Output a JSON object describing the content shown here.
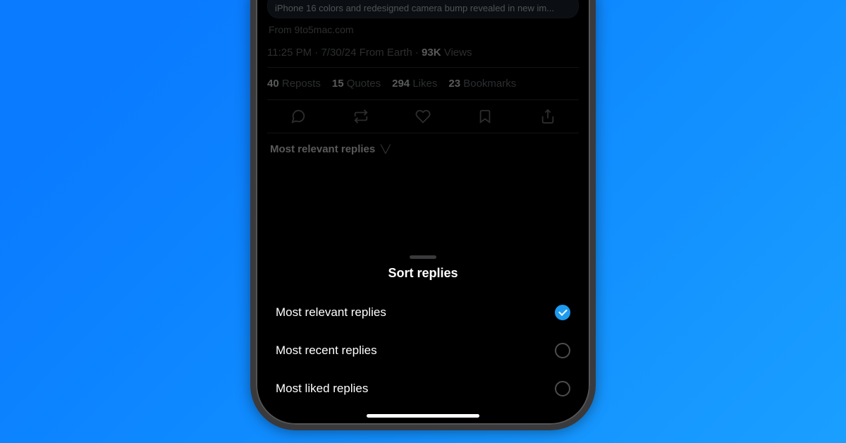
{
  "card": {
    "caption": "iPhone 16 colors and redesigned camera bump revealed in new im...",
    "source": "From 9to5mac.com"
  },
  "meta": {
    "time": "11:25 PM",
    "date": "7/30/24",
    "from": "From Earth",
    "views_count": "93K",
    "views_label": "Views"
  },
  "stats": {
    "reposts_n": "40",
    "reposts_l": "Reposts",
    "quotes_n": "15",
    "quotes_l": "Quotes",
    "likes_n": "294",
    "likes_l": "Likes",
    "bookmarks_n": "23",
    "bookmarks_l": "Bookmarks"
  },
  "sort_trigger": "Most relevant replies",
  "sheet": {
    "title": "Sort replies",
    "options": [
      {
        "label": "Most relevant replies",
        "selected": true
      },
      {
        "label": "Most recent replies",
        "selected": false
      },
      {
        "label": "Most liked replies",
        "selected": false
      }
    ]
  }
}
